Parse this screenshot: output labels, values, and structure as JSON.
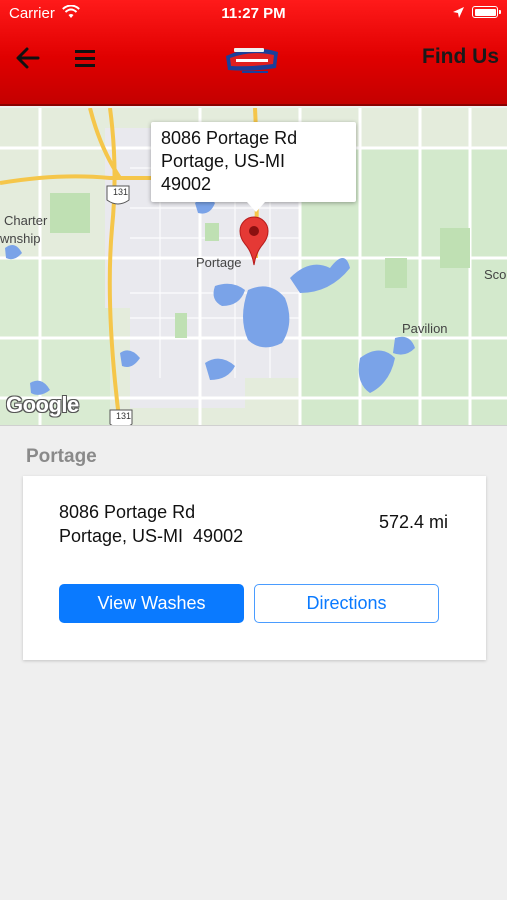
{
  "status_bar": {
    "carrier": "Carrier",
    "time": "11:27 PM"
  },
  "header": {
    "title": "Find Us",
    "logo_alt": "Shiny Brite Car Wash"
  },
  "map": {
    "info_window": {
      "line1": "8086 Portage Rd",
      "line2": "Portage, US-MI",
      "line3": "49002"
    },
    "labels": {
      "charter": "Charter",
      "township": "wnship",
      "portage": "Portage",
      "pavilion": "Pavilion",
      "sco": "Sco"
    },
    "shields": {
      "hwy1": "131",
      "hwy2": "131"
    },
    "attribution": "Google"
  },
  "location": {
    "name": "Portage",
    "address_line1": "8086 Portage Rd",
    "address_line2": "Portage, US-MI  49002",
    "distance": "572.4 mi"
  },
  "buttons": {
    "view_washes": "View Washes",
    "directions": "Directions"
  },
  "colors": {
    "header_red": "#e00000",
    "accent_blue": "#0a7aff",
    "pin_red": "#e53935"
  }
}
